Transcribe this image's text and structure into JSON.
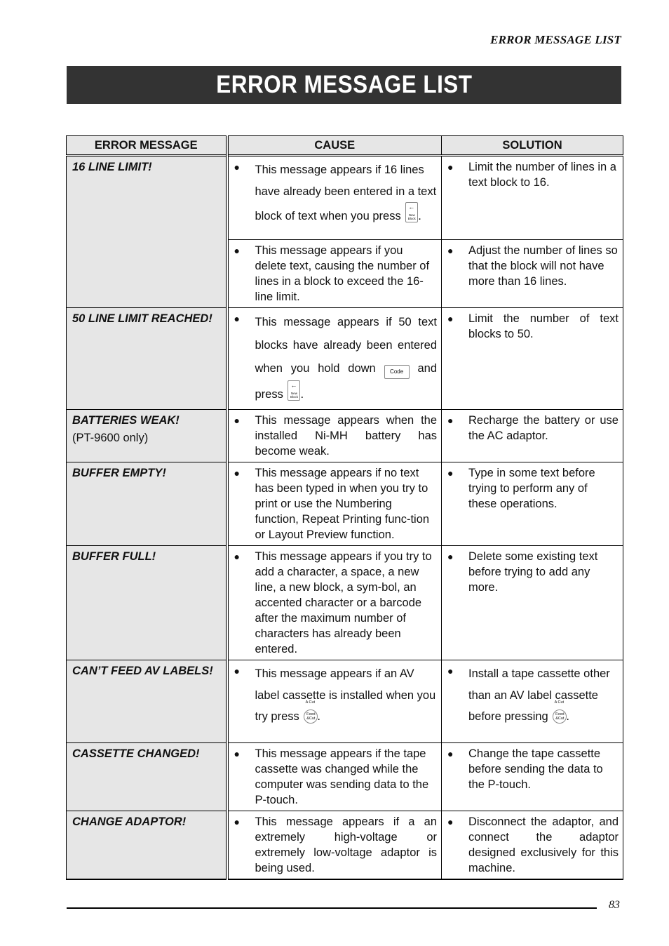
{
  "running_head": "ERROR MESSAGE LIST",
  "title": "ERROR MESSAGE LIST",
  "table": {
    "headers": [
      "ERROR MESSAGE",
      "CAUSE",
      "SOLUTION"
    ],
    "keys": {
      "new_block_arrow": "←",
      "new_block_label": "New Block",
      "code_label": "Code",
      "feed_top_label": "A Cut",
      "feed_label": "Feed &Cut"
    },
    "rows": [
      {
        "message": "16 LINE LIMIT!",
        "entries": [
          {
            "cause_pre": "This message appears if 16 lines have already been entered in a text block of text when you press",
            "cause_post": ".",
            "solution": "Limit the number of lines in a text block to 16."
          },
          {
            "cause": "This message appears if you delete text, causing the number of lines in a block to exceed the 16-line limit.",
            "solution": "Adjust the number of lines so that the block will not have more than 16 lines."
          }
        ]
      },
      {
        "message": "50 LINE LIMIT REACHED!",
        "cause_pre": "This message appears if 50 text blocks have already been entered when you hold down",
        "cause_mid": "and press",
        "cause_post": ".",
        "solution": "Limit the number of text blocks to 50."
      },
      {
        "message": "BATTERIES WEAK!",
        "note": "(PT-9600 only)",
        "cause": "This message appears when the installed Ni-MH battery has become weak.",
        "solution": "Recharge the battery or use the AC adaptor."
      },
      {
        "message": "BUFFER EMPTY!",
        "cause": "This message appears if no text has been typed in when you try to print or use the Numbering function, Repeat Printing func-tion or Layout Preview function.",
        "solution": "Type in some text before trying to perform any of these operations."
      },
      {
        "message": "BUFFER FULL!",
        "cause": "This message appears if you try to add a character, a space, a new line, a new block, a sym-bol, an accented character or a barcode after the maximum number of characters has already been entered.",
        "solution": "Delete some existing text before trying to add any more."
      },
      {
        "message": "CAN’T FEED AV LABELS!",
        "cause_pre": "This message appears if an AV label cassette is installed when you try press",
        "cause_post": ".",
        "solution_pre": "Install a tape cassette other than an AV label cassette before pressing",
        "solution_post": "."
      },
      {
        "message": "CASSETTE CHANGED!",
        "cause": "This message appears if the tape cassette was changed while the computer was sending data to the P-touch.",
        "solution": "Change the tape cassette before sending the data to the P-touch."
      },
      {
        "message": "CHANGE ADAPTOR!",
        "cause": "This message appears if a an extremely high-voltage or extremely low-voltage adaptor is being used.",
        "solution": "Disconnect the adaptor, and connect the adaptor designed exclusively for this machine."
      }
    ],
    "bullet": "●"
  },
  "page_number": "83"
}
